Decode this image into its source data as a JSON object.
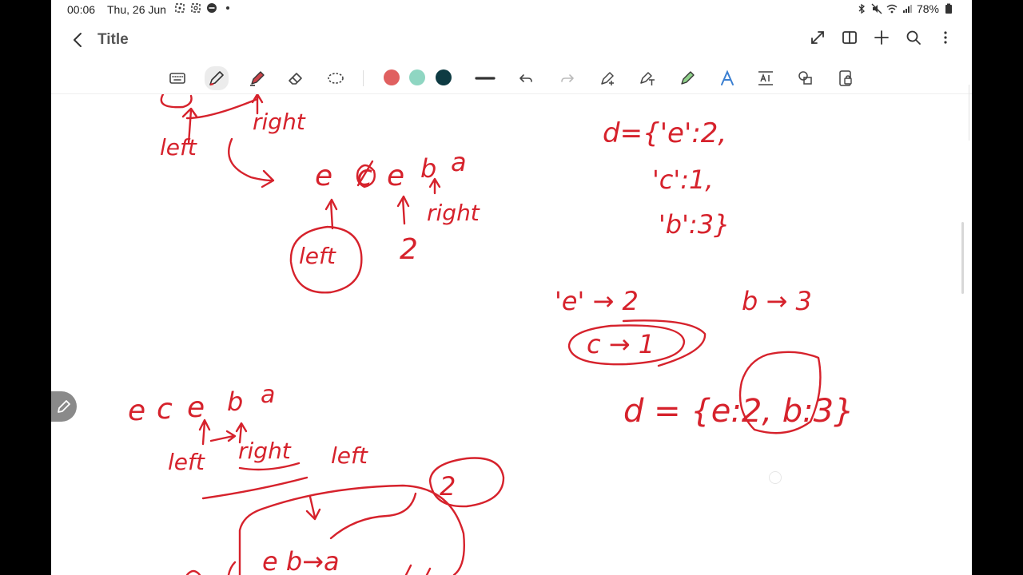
{
  "status_bar": {
    "time": "00:06",
    "date": "Thu, 26 Jun",
    "battery": "78%"
  },
  "title_bar": {
    "title": "Title"
  },
  "toolbar": {
    "pen_colors": [
      "#e06060",
      "#8fd6c2",
      "#0e3b43"
    ]
  },
  "canvas": {
    "ink_color": "#d6222c",
    "handwriting": {
      "top_right_label": "right",
      "top_left_label": "left",
      "string_top": [
        "e",
        "c",
        "e",
        "b",
        "a"
      ],
      "pointer_right": "right",
      "pointer_left": "left",
      "count_two": "2",
      "dict_line1": "d={'e':2,",
      "dict_line2": "'c':1,",
      "dict_line3": "'b':3}",
      "map_e": "'e' → 2",
      "map_b": "b → 3",
      "map_c": "c → 1",
      "dict_result": "d = {e:2, b:3}",
      "string_bottom": [
        "e",
        "c",
        "e",
        "b",
        "a"
      ],
      "bottom_left": "left",
      "bottom_right": "right",
      "bottom_left2": "left",
      "bottom_two": "2",
      "bottom_window": "e b→a"
    }
  }
}
